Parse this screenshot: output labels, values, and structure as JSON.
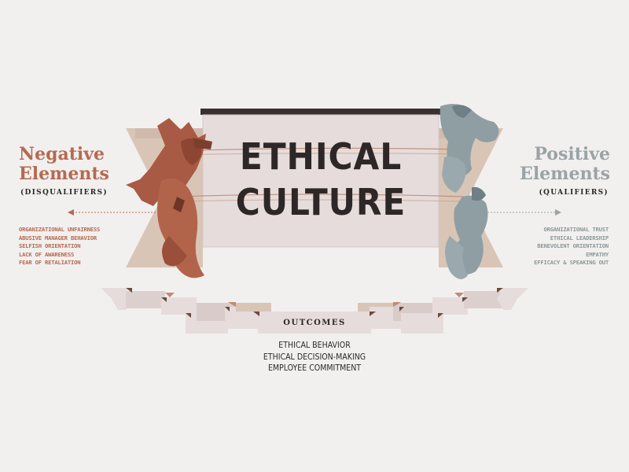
{
  "main": {
    "title_line1": "ETHICAL",
    "title_line2": "CULTURE"
  },
  "negative": {
    "title_line1": "Negative",
    "title_line2": "Elements",
    "subtitle": "(DISQUALIFIERS)",
    "items": [
      "ORGANIZATIONAL UNFAIRNESS",
      "ABUSIVE MANAGER BEHAVIOR",
      "SELFISH ORIENTATION",
      "LACK OF AWARENESS",
      "FEAR OF RETALIATION"
    ]
  },
  "positive": {
    "title_line1": "Positive",
    "title_line2": "Elements",
    "subtitle": "(QUALIFIERS)",
    "items": [
      "ORGANIZATIONAL TRUST",
      "ETHICAL LEADERSHIP",
      "BENEVOLENT ORIENTATION",
      "EMPATHY",
      "EFFICACY & SPEAKING OUT"
    ]
  },
  "outcomes": {
    "label": "OUTCOMES",
    "items": [
      "ETHICAL BEHAVIOR",
      "ETHICAL DECISION-MAKING",
      "EMPLOYEE COMMITMENT"
    ]
  },
  "colors": {
    "background": "#f2f0ef",
    "negative_accent": "#b56a52",
    "positive_accent": "#9aa3a6",
    "dark": "#2d2728",
    "ribbon_pink": "#e6dcdc",
    "ribbon_tan": "#d9c5b6"
  },
  "icons": {
    "left_figure": "devil-figures-illustration",
    "right_figure": "cherub-figures-illustration"
  }
}
